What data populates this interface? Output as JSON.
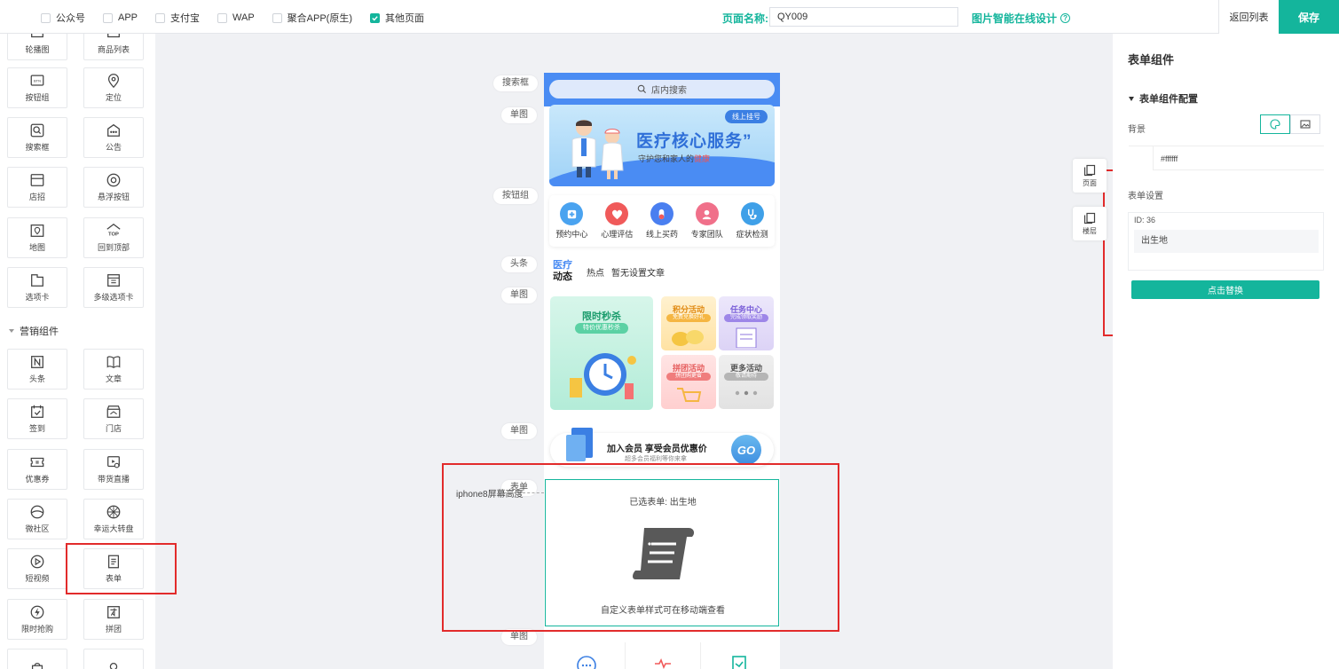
{
  "topbar": {
    "platforms": [
      {
        "label": "公众号",
        "checked": false
      },
      {
        "label": "APP",
        "checked": false
      },
      {
        "label": "支付宝",
        "checked": false
      },
      {
        "label": "WAP",
        "checked": false
      },
      {
        "label": "聚合APP(原生)",
        "checked": false
      },
      {
        "label": "其他页面",
        "checked": true
      }
    ],
    "page_name_label": "页面名称:",
    "page_name_value": "QY009",
    "smart_design": "图片智能在线设计",
    "help_glyph": "?",
    "return_label": "返回列表",
    "save_label": "保存"
  },
  "left_panel": {
    "components_top": [
      "轮播图",
      "商品列表",
      "按钮组",
      "定位",
      "搜索框",
      "公告",
      "店招",
      "悬浮按钮",
      "地图",
      "回到顶部",
      "选项卡",
      "多级选项卡"
    ],
    "section_marketing": "营销组件",
    "components_marketing": [
      "头条",
      "文章",
      "签到",
      "门店",
      "优惠券",
      "带货直播",
      "微社区",
      "幸运大转盘",
      "短视频",
      "表单",
      "限时抢购",
      "拼团"
    ],
    "top_badge": "TOP",
    "btn_badge": "BTN"
  },
  "canvas_labels": {
    "search": "搜索框",
    "image1": "单图",
    "buttons": "按钮组",
    "headline": "头条",
    "image2": "单图",
    "image3": "单图",
    "form": "表单",
    "image4": "单图",
    "iphone": "iphone8屏幕高度"
  },
  "phone": {
    "search_placeholder": "店内搜索",
    "banner": {
      "tag": "线上挂号",
      "title": "医疗核心服务",
      "quote": "”",
      "subtitle_pre": "守护您和家人的",
      "subtitle_hl": "健康"
    },
    "icons": [
      {
        "label": "预约中心",
        "color": "#4aa3f0"
      },
      {
        "label": "心理评估",
        "color": "#f05a5a"
      },
      {
        "label": "线上买药",
        "color": "#4a7ff0"
      },
      {
        "label": "专家团队",
        "color": "#f0708a"
      },
      {
        "label": "症状检测",
        "color": "#3fa0e8"
      }
    ],
    "news": {
      "logo_top": "医疗",
      "logo_bottom": "动态",
      "hot": "热点",
      "text": "暂无设置文章"
    },
    "tiles": {
      "flash_title": "限时秒杀",
      "flash_sub": "特价优惠秒杀",
      "points_title": "积分活动",
      "points_sub": "免费兑换好礼",
      "task_title": "任务中心",
      "task_sub": "完成领取奖励",
      "group_title": "拼团活动",
      "group_sub": "拼团购更省",
      "more_title": "更多活动",
      "more_sub": "敬请期待"
    },
    "vip": {
      "title": "加入会员 享受会员优惠价",
      "sub": "超多会员福利等你来拿",
      "go": "GO"
    },
    "form_card": {
      "selected": "已选表单: 出生地",
      "tip": "自定义表单样式可在移动端查看"
    }
  },
  "side_buttons": {
    "page": "页面",
    "floor": "楼层"
  },
  "right_panel": {
    "title": "表单组件",
    "section": "表单组件配置",
    "bg_label": "背景",
    "bg_color": "#ffffff",
    "form_settings": "表单设置",
    "id_text": "ID:  36",
    "field_value": "出生地",
    "replace_btn": "点击替换"
  },
  "colors": {
    "accent": "#14b59c",
    "highlight": "#e22b2b",
    "phone_blue": "#4a8cf3"
  }
}
